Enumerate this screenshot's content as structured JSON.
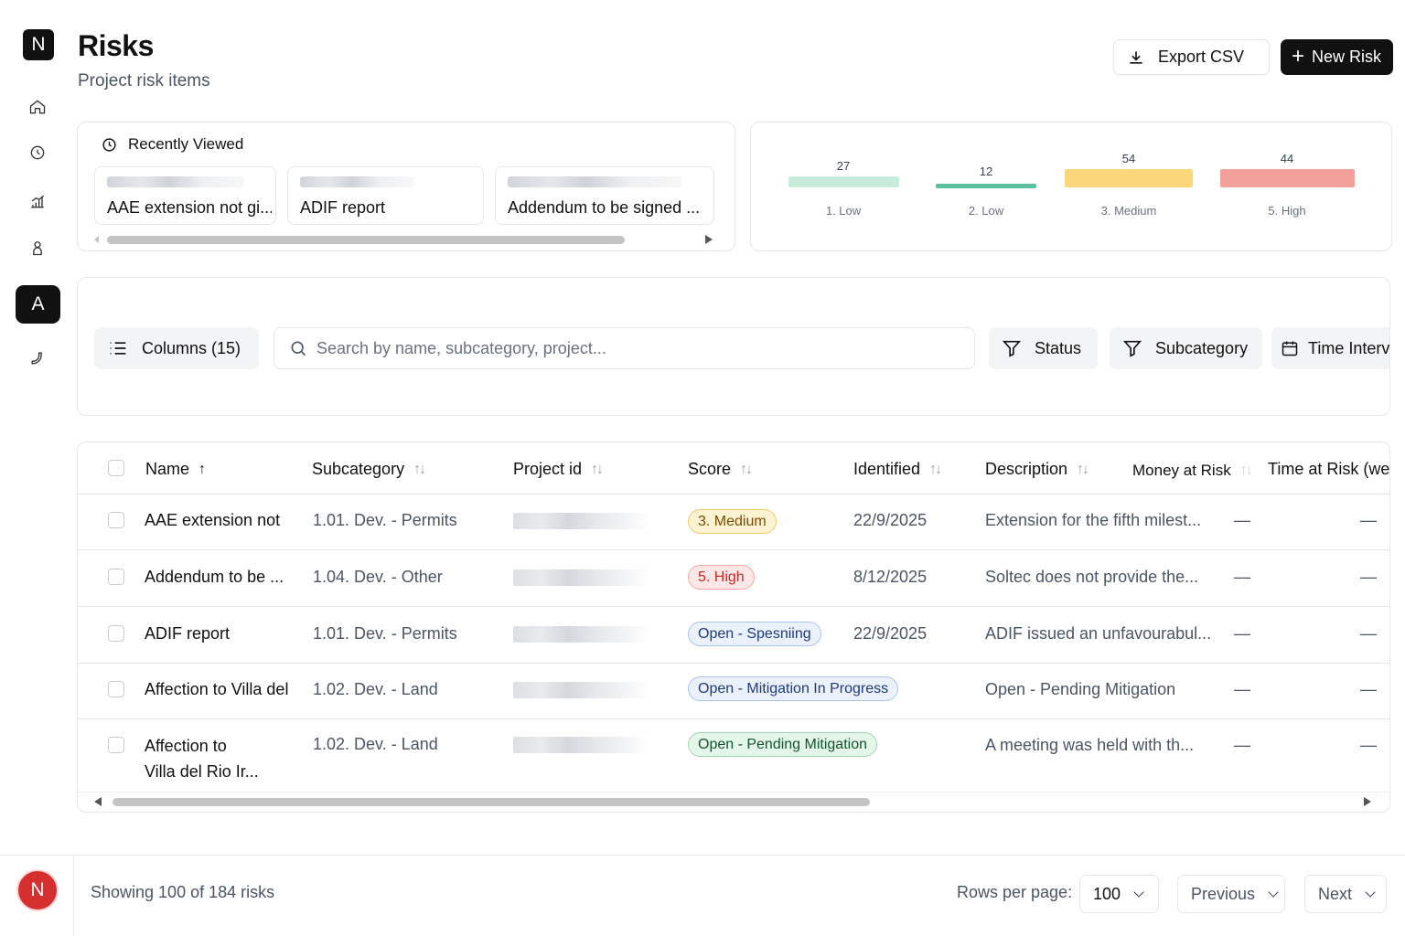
{
  "app": {
    "logo_letter": "N",
    "active_nav_letter": "A",
    "avatar_letter": "N"
  },
  "sidebar": {
    "icons": [
      "home-icon",
      "clock-icon",
      "chart-icon",
      "person-icon",
      "a-icon",
      "phone-icon"
    ]
  },
  "header": {
    "title": "Risks",
    "subtitle": "Project risk items",
    "export_label": "Export CSV",
    "new_label": "New Risk"
  },
  "recent": {
    "title": "Recently Viewed",
    "items": [
      {
        "label": "AAE extension not gi..."
      },
      {
        "label": "ADIF report"
      },
      {
        "label": "Addendum to be signed  ..."
      }
    ]
  },
  "chart_data": {
    "type": "bar",
    "categories": [
      "1. Low",
      "2. Low",
      "3. Medium",
      "5. High"
    ],
    "values": [
      27,
      12,
      54,
      44
    ],
    "colors": [
      "#c8ecdb",
      "#5cc0a0",
      "#fbd67a",
      "#f4a09a"
    ]
  },
  "toolbar": {
    "columns_label": "Columns (15)",
    "search_placeholder": "Search by name, subcategory, project...",
    "filters": [
      "Status",
      "Subcategory",
      "Time Interv"
    ]
  },
  "table": {
    "headers": [
      "Name",
      "Subcategory",
      "Project id",
      "Score",
      "Identified",
      "Description",
      "Money at Risk",
      "Time at Risk (wek"
    ],
    "rows": [
      {
        "name": "AAE extension not",
        "subcategory": "1.01. Dev. - Permits",
        "score": "3. Medium",
        "score_style": "medium",
        "identified": "22/9/2025",
        "description": "Extension for the fifth milest...",
        "money": "—",
        "time": "—"
      },
      {
        "name": "Addendum to be ...",
        "subcategory": "1.04. Dev. - Other",
        "score": "5. High",
        "score_style": "high",
        "identified": "8/12/2025",
        "description": "Soltec does not provide the...",
        "money": "—",
        "time": "—"
      },
      {
        "name": "ADIF report",
        "subcategory": "1.01. Dev. - Permits",
        "score": "Open - Spesniing",
        "score_style": "blue",
        "identified": "22/9/2025",
        "description": "ADIF issued an unfavourabul...",
        "money": "—",
        "time": "—"
      },
      {
        "name": "Affection to Villa del",
        "subcategory": "1.02. Dev. - Land",
        "score": "Open - Mitigation In Progress",
        "score_style": "blue",
        "identified": "",
        "description": "Open - Pending Mitigation",
        "money": "—",
        "time": "—"
      },
      {
        "name_line1": "Affection to",
        "name_line2": "Villa del Rio Ir...",
        "subcategory": "1.02. Dev. - Land",
        "score": "Open - Pending Mitigation",
        "score_style": "green",
        "identified": "",
        "description": "A meeting was held with th...",
        "money": "—",
        "time": "—"
      }
    ]
  },
  "footer": {
    "showing": "Showing 100 of 184 risks",
    "rows_per_page_label": "Rows per page:",
    "rows_per_page_value": "100",
    "previous_label": "Previous",
    "next_label": "Next"
  }
}
